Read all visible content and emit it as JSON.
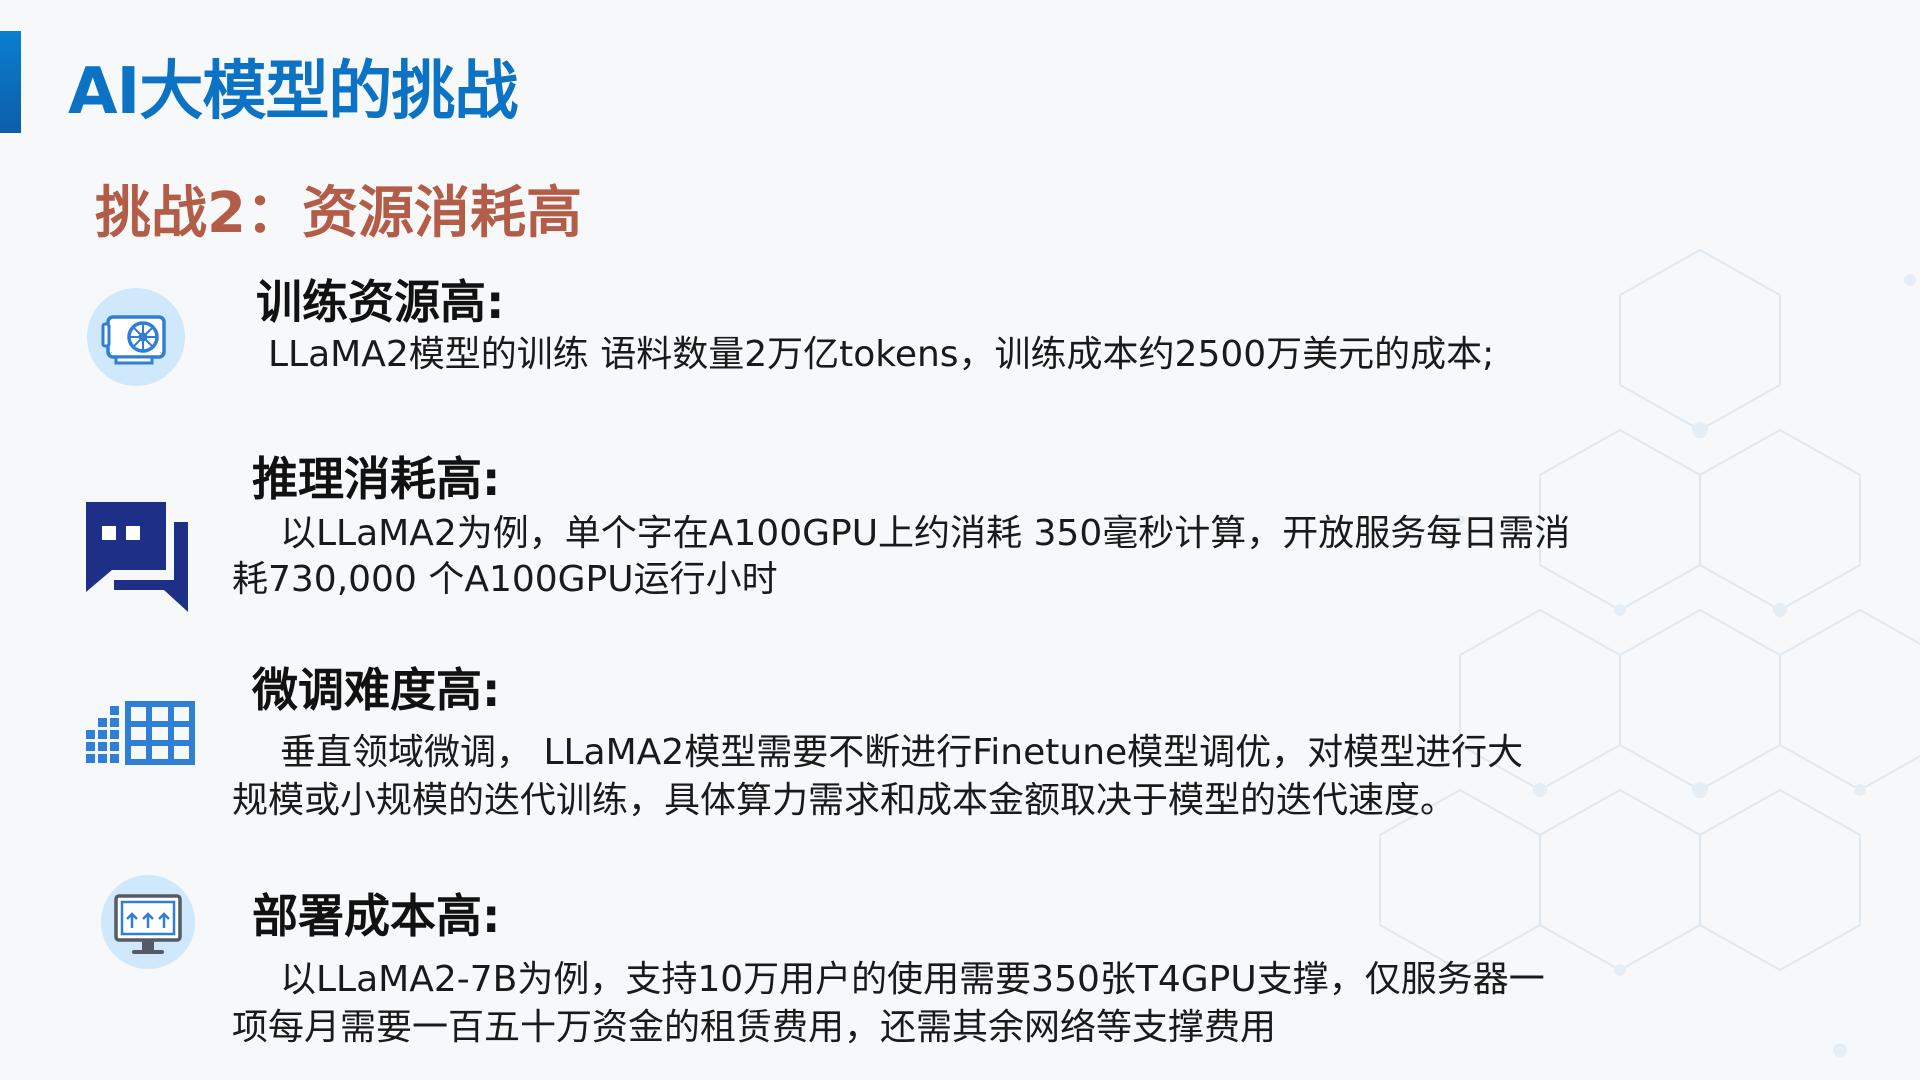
{
  "slide": {
    "title": "AI大模型的挑战",
    "subtitle": "挑战2：资源消耗高"
  },
  "items": [
    {
      "heading": "训练资源高:",
      "lines": [
        "LLaMA2模型的训练 语料数量2万亿tokens，训练成本约2500万美元的成本;"
      ],
      "icon": "gpu-card-icon"
    },
    {
      "heading": "推理消耗高:",
      "lines": [
        "以LLaMA2为例，单个字在A100GPU上约消耗 350毫秒计算，开放服务每日需消",
        "耗730,000 个A100GPU运行小时"
      ],
      "icon": "chat-bubble-icon"
    },
    {
      "heading": "微调难度高:",
      "lines": [
        "垂直领域微调， LLaMA2模型需要不断进行Finetune模型调优，对模型进行大",
        "规模或小规模的迭代训练，具体算力需求和成本金额取决于模型的迭代速度。"
      ],
      "icon": "server-grid-icon"
    },
    {
      "heading": "部署成本高:",
      "lines": [
        "以LLaMA2-7B为例，支持10万用户的使用需要350张T4GPU支撑，仅服务器一",
        "项每月需要一百五十万资金的租赁费用，还需其余网络等支撑费用"
      ],
      "icon": "monitor-upload-icon"
    }
  ],
  "colors": {
    "title": "#0b72c4",
    "subtitle": "#b35c48",
    "icon_blue": "#2f7fd6",
    "icon_navy": "#1d2f86"
  }
}
